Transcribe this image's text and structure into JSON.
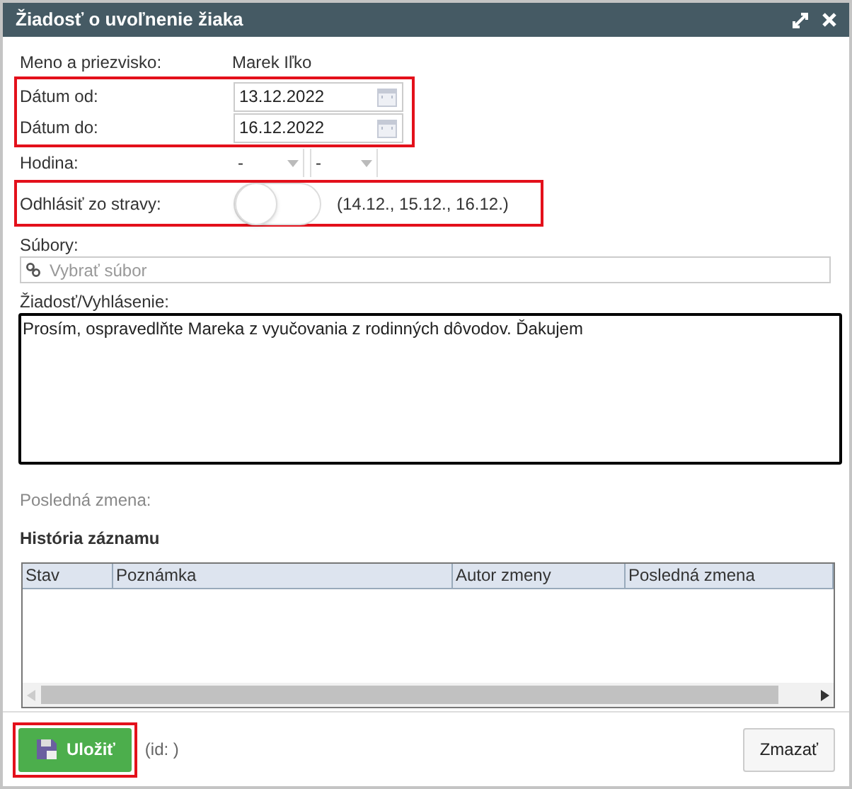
{
  "window": {
    "title": "Žiadosť o uvoľnenie žiaka"
  },
  "name": {
    "label": "Meno a priezvisko:",
    "value": "Marek Iľko"
  },
  "date_from": {
    "label": "Dátum od:",
    "value": "13.12.2022"
  },
  "date_to": {
    "label": "Dátum do:",
    "value": "16.12.2022"
  },
  "hour": {
    "label": "Hodina:",
    "from": "-",
    "to": "-"
  },
  "meals": {
    "label": "Odhlásiť zo stravy:",
    "on": false,
    "days": "(14.12., 15.12., 16.12.)"
  },
  "files": {
    "label": "Súbory:",
    "placeholder": "Vybrať súbor"
  },
  "request": {
    "label": "Žiadosť/Vyhlásenie:",
    "value": "Prosím, ospravedlňte Mareka z vyučovania z rodinných dôvodov. Ďakujem"
  },
  "last_change": {
    "label": "Posledná zmena:"
  },
  "history": {
    "title": "História záznamu",
    "columns": [
      "Stav",
      "Poznámka",
      "Autor zmeny",
      "Posledná zmena"
    ]
  },
  "footer": {
    "save": "Uložiť",
    "id": "(id: )",
    "delete": "Zmazať"
  }
}
